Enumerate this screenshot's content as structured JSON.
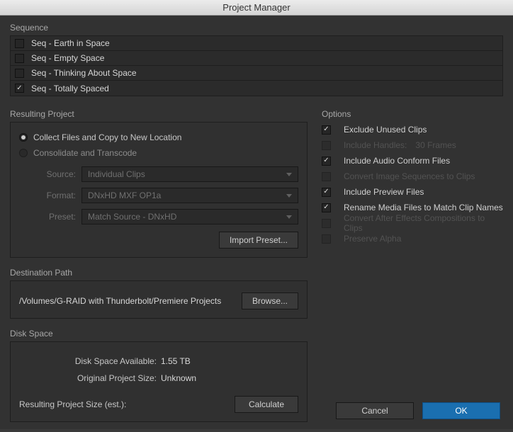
{
  "window": {
    "title": "Project Manager"
  },
  "sequence": {
    "label": "Sequence",
    "items": [
      {
        "name": "Seq - Earth in Space",
        "checked": false
      },
      {
        "name": "Seq - Empty Space",
        "checked": false
      },
      {
        "name": "Seq - Thinking About Space",
        "checked": false
      },
      {
        "name": "Seq - Totally Spaced",
        "checked": true
      }
    ]
  },
  "resulting": {
    "label": "Resulting Project",
    "radios": {
      "collect": {
        "label": "Collect Files and Copy to New Location",
        "selected": true
      },
      "consolidate": {
        "label": "Consolidate and Transcode",
        "selected": false
      }
    },
    "source": {
      "label": "Source:",
      "value": "Individual Clips"
    },
    "format": {
      "label": "Format:",
      "value": "DNxHD MXF OP1a"
    },
    "preset": {
      "label": "Preset:",
      "value": "Match Source - DNxHD"
    },
    "import_preset_btn": "Import Preset..."
  },
  "options": {
    "label": "Options",
    "items": [
      {
        "label": "Exclude Unused Clips",
        "checked": true,
        "enabled": true
      },
      {
        "label": "Include Handles:",
        "value": "30 Frames",
        "checked": false,
        "enabled": false
      },
      {
        "label": "Include Audio Conform Files",
        "checked": true,
        "enabled": true
      },
      {
        "label": "Convert Image Sequences to Clips",
        "checked": false,
        "enabled": false
      },
      {
        "label": "Include Preview Files",
        "checked": true,
        "enabled": true
      },
      {
        "label": "Rename Media Files to Match Clip Names",
        "checked": true,
        "enabled": true
      },
      {
        "label": "Convert After Effects Compositions to Clips",
        "checked": false,
        "enabled": false
      },
      {
        "label": "Preserve Alpha",
        "checked": false,
        "enabled": false
      }
    ]
  },
  "destination": {
    "label": "Destination Path",
    "path": "/Volumes/G-RAID with Thunderbolt/Premiere Projects",
    "browse_btn": "Browse..."
  },
  "disk": {
    "label": "Disk Space",
    "available_label": "Disk Space Available:",
    "available_value": "1.55 TB",
    "orig_label": "Original Project Size:",
    "orig_value": "Unknown",
    "result_label": "Resulting Project Size (est.):",
    "calc_btn": "Calculate"
  },
  "footer": {
    "cancel": "Cancel",
    "ok": "OK"
  }
}
